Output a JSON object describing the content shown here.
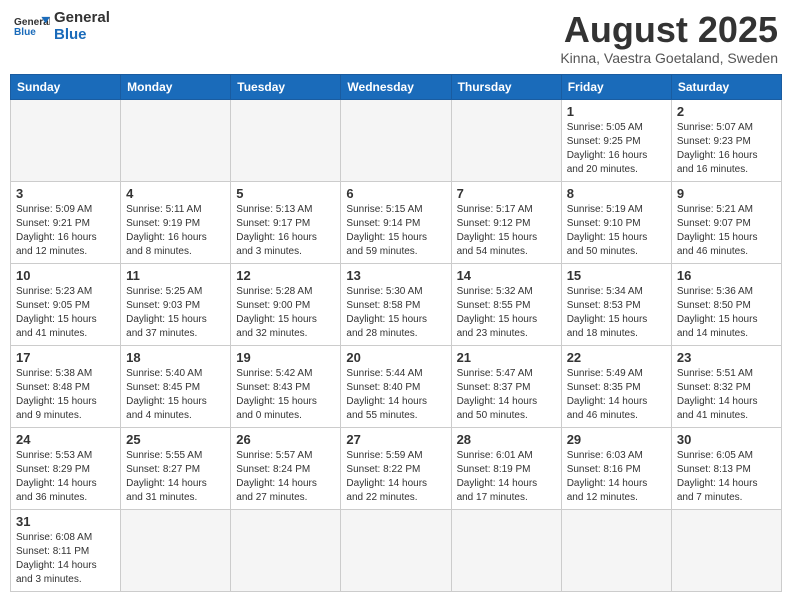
{
  "logo": {
    "text_general": "General",
    "text_blue": "Blue"
  },
  "title": "August 2025",
  "subtitle": "Kinna, Vaestra Goetaland, Sweden",
  "days_of_week": [
    "Sunday",
    "Monday",
    "Tuesday",
    "Wednesday",
    "Thursday",
    "Friday",
    "Saturday"
  ],
  "weeks": [
    [
      {
        "day": "",
        "info": ""
      },
      {
        "day": "",
        "info": ""
      },
      {
        "day": "",
        "info": ""
      },
      {
        "day": "",
        "info": ""
      },
      {
        "day": "",
        "info": ""
      },
      {
        "day": "1",
        "info": "Sunrise: 5:05 AM\nSunset: 9:25 PM\nDaylight: 16 hours\nand 20 minutes."
      },
      {
        "day": "2",
        "info": "Sunrise: 5:07 AM\nSunset: 9:23 PM\nDaylight: 16 hours\nand 16 minutes."
      }
    ],
    [
      {
        "day": "3",
        "info": "Sunrise: 5:09 AM\nSunset: 9:21 PM\nDaylight: 16 hours\nand 12 minutes."
      },
      {
        "day": "4",
        "info": "Sunrise: 5:11 AM\nSunset: 9:19 PM\nDaylight: 16 hours\nand 8 minutes."
      },
      {
        "day": "5",
        "info": "Sunrise: 5:13 AM\nSunset: 9:17 PM\nDaylight: 16 hours\nand 3 minutes."
      },
      {
        "day": "6",
        "info": "Sunrise: 5:15 AM\nSunset: 9:14 PM\nDaylight: 15 hours\nand 59 minutes."
      },
      {
        "day": "7",
        "info": "Sunrise: 5:17 AM\nSunset: 9:12 PM\nDaylight: 15 hours\nand 54 minutes."
      },
      {
        "day": "8",
        "info": "Sunrise: 5:19 AM\nSunset: 9:10 PM\nDaylight: 15 hours\nand 50 minutes."
      },
      {
        "day": "9",
        "info": "Sunrise: 5:21 AM\nSunset: 9:07 PM\nDaylight: 15 hours\nand 46 minutes."
      }
    ],
    [
      {
        "day": "10",
        "info": "Sunrise: 5:23 AM\nSunset: 9:05 PM\nDaylight: 15 hours\nand 41 minutes."
      },
      {
        "day": "11",
        "info": "Sunrise: 5:25 AM\nSunset: 9:03 PM\nDaylight: 15 hours\nand 37 minutes."
      },
      {
        "day": "12",
        "info": "Sunrise: 5:28 AM\nSunset: 9:00 PM\nDaylight: 15 hours\nand 32 minutes."
      },
      {
        "day": "13",
        "info": "Sunrise: 5:30 AM\nSunset: 8:58 PM\nDaylight: 15 hours\nand 28 minutes."
      },
      {
        "day": "14",
        "info": "Sunrise: 5:32 AM\nSunset: 8:55 PM\nDaylight: 15 hours\nand 23 minutes."
      },
      {
        "day": "15",
        "info": "Sunrise: 5:34 AM\nSunset: 8:53 PM\nDaylight: 15 hours\nand 18 minutes."
      },
      {
        "day": "16",
        "info": "Sunrise: 5:36 AM\nSunset: 8:50 PM\nDaylight: 15 hours\nand 14 minutes."
      }
    ],
    [
      {
        "day": "17",
        "info": "Sunrise: 5:38 AM\nSunset: 8:48 PM\nDaylight: 15 hours\nand 9 minutes."
      },
      {
        "day": "18",
        "info": "Sunrise: 5:40 AM\nSunset: 8:45 PM\nDaylight: 15 hours\nand 4 minutes."
      },
      {
        "day": "19",
        "info": "Sunrise: 5:42 AM\nSunset: 8:43 PM\nDaylight: 15 hours\nand 0 minutes."
      },
      {
        "day": "20",
        "info": "Sunrise: 5:44 AM\nSunset: 8:40 PM\nDaylight: 14 hours\nand 55 minutes."
      },
      {
        "day": "21",
        "info": "Sunrise: 5:47 AM\nSunset: 8:37 PM\nDaylight: 14 hours\nand 50 minutes."
      },
      {
        "day": "22",
        "info": "Sunrise: 5:49 AM\nSunset: 8:35 PM\nDaylight: 14 hours\nand 46 minutes."
      },
      {
        "day": "23",
        "info": "Sunrise: 5:51 AM\nSunset: 8:32 PM\nDaylight: 14 hours\nand 41 minutes."
      }
    ],
    [
      {
        "day": "24",
        "info": "Sunrise: 5:53 AM\nSunset: 8:29 PM\nDaylight: 14 hours\nand 36 minutes."
      },
      {
        "day": "25",
        "info": "Sunrise: 5:55 AM\nSunset: 8:27 PM\nDaylight: 14 hours\nand 31 minutes."
      },
      {
        "day": "26",
        "info": "Sunrise: 5:57 AM\nSunset: 8:24 PM\nDaylight: 14 hours\nand 27 minutes."
      },
      {
        "day": "27",
        "info": "Sunrise: 5:59 AM\nSunset: 8:22 PM\nDaylight: 14 hours\nand 22 minutes."
      },
      {
        "day": "28",
        "info": "Sunrise: 6:01 AM\nSunset: 8:19 PM\nDaylight: 14 hours\nand 17 minutes."
      },
      {
        "day": "29",
        "info": "Sunrise: 6:03 AM\nSunset: 8:16 PM\nDaylight: 14 hours\nand 12 minutes."
      },
      {
        "day": "30",
        "info": "Sunrise: 6:05 AM\nSunset: 8:13 PM\nDaylight: 14 hours\nand 7 minutes."
      }
    ],
    [
      {
        "day": "31",
        "info": "Sunrise: 6:08 AM\nSunset: 8:11 PM\nDaylight: 14 hours\nand 3 minutes."
      },
      {
        "day": "",
        "info": ""
      },
      {
        "day": "",
        "info": ""
      },
      {
        "day": "",
        "info": ""
      },
      {
        "day": "",
        "info": ""
      },
      {
        "day": "",
        "info": ""
      },
      {
        "day": "",
        "info": ""
      }
    ]
  ]
}
